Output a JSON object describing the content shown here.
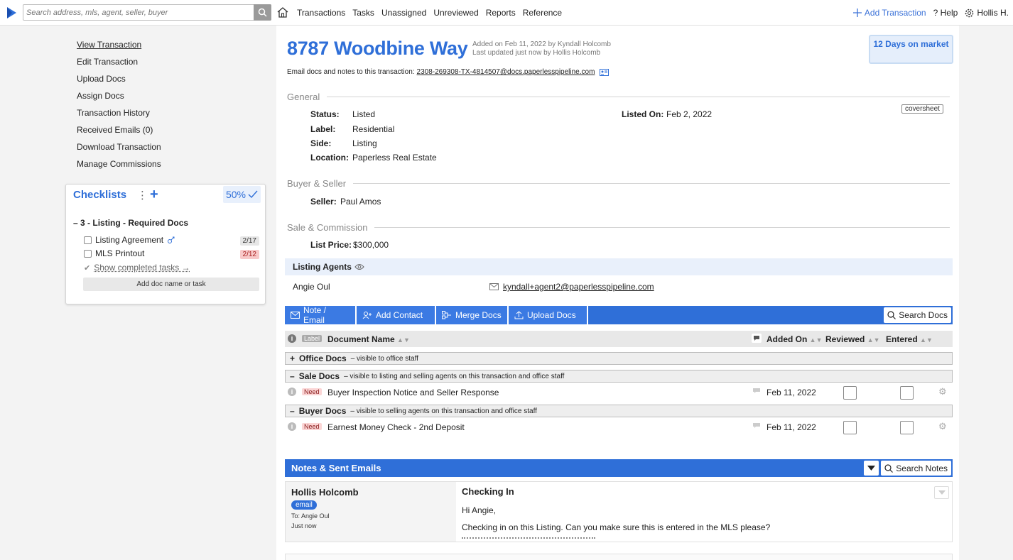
{
  "search": {
    "placeholder": "Search address, mls, agent, seller, buyer"
  },
  "nav": [
    "Transactions",
    "Tasks",
    "Unassigned",
    "Unreviewed",
    "Reports",
    "Reference"
  ],
  "topright": {
    "add_transaction": "Add Transaction",
    "help": "Help",
    "user": "Hollis H."
  },
  "sidebar": {
    "links": [
      "View Transaction",
      "Edit Transaction",
      "Upload Docs",
      "Assign Docs",
      "Transaction History",
      "Received Emails (0)",
      "Download Transaction",
      "Manage Commissions"
    ]
  },
  "checklists": {
    "title": "Checklists",
    "percent": "50%",
    "group": "3 - Listing - Required Docs",
    "items": [
      {
        "label": "Listing Agreement",
        "count": "2/17"
      },
      {
        "label": "MLS Printout",
        "count": "2/12"
      }
    ],
    "show_completed": "Show completed tasks →",
    "add_placeholder": "Add doc name or task"
  },
  "transaction": {
    "address": "8787 Woodbine Way",
    "added": "Added on Feb 11, 2022 by Kyndall Holcomb",
    "updated": "Last updated just now by Hollis Holcomb",
    "days_on_market": "12 Days on market",
    "email_prefix": "Email docs and notes to this transaction:",
    "email_address": "2308-269308-TX-4814507@docs.paperlesspipeline.com"
  },
  "general": {
    "heading": "General",
    "status_label": "Status:",
    "status": "Listed",
    "label_label": "Label:",
    "label": "Residential",
    "side_label": "Side:",
    "side": "Listing",
    "location_label": "Location:",
    "location": "Paperless Real Estate",
    "listed_on_label": "Listed On:",
    "listed_on": "Feb 2, 2022",
    "coversheet": "coversheet"
  },
  "buyer_seller": {
    "heading": "Buyer & Seller",
    "seller_label": "Seller:",
    "seller": "Paul Amos"
  },
  "sale": {
    "heading": "Sale & Commission",
    "list_price_label": "List Price:",
    "list_price": "$300,000"
  },
  "agents": {
    "heading": "Listing Agents",
    "name": "Angie Oul",
    "email": "kyndall+agent2@paperlesspipeline.com"
  },
  "toolbar": {
    "note_email": "Note / Email",
    "add_contact": "Add Contact",
    "merge_docs": "Merge Docs",
    "upload_docs": "Upload Docs",
    "search_docs": "Search Docs"
  },
  "docs_header": {
    "label": "Label",
    "document_name": "Document Name",
    "added_on": "Added On",
    "reviewed": "Reviewed",
    "entered": "Entered"
  },
  "doc_groups": [
    {
      "name": "Office Docs",
      "desc": "– visible to office staff",
      "toggle": "+"
    },
    {
      "name": "Sale Docs",
      "desc": "– visible to listing and selling agents on this transaction and office staff",
      "toggle": "–"
    },
    {
      "name": "Buyer Docs",
      "desc": "– visible to selling agents on this transaction and office staff",
      "toggle": "–"
    }
  ],
  "docs": [
    {
      "tag": "Need",
      "name": "Buyer Inspection Notice and Seller Response",
      "added": "Feb 11, 2022"
    },
    {
      "tag": "Need",
      "name": "Earnest Money Check - 2nd Deposit",
      "added": "Feb 11, 2022"
    }
  ],
  "notes": {
    "heading": "Notes & Sent Emails",
    "search": "Search Notes",
    "author": "Hollis Holcomb",
    "type": "email",
    "to": "To: Angie Oul",
    "time": "Just now",
    "subject": "Checking In",
    "greeting": "Hi Angie,",
    "body": "Checking in on this Listing. Can you make sure this is entered in the MLS please?"
  },
  "colors": {
    "accent": "#2f6fd8",
    "need": "#fbd5d5"
  }
}
